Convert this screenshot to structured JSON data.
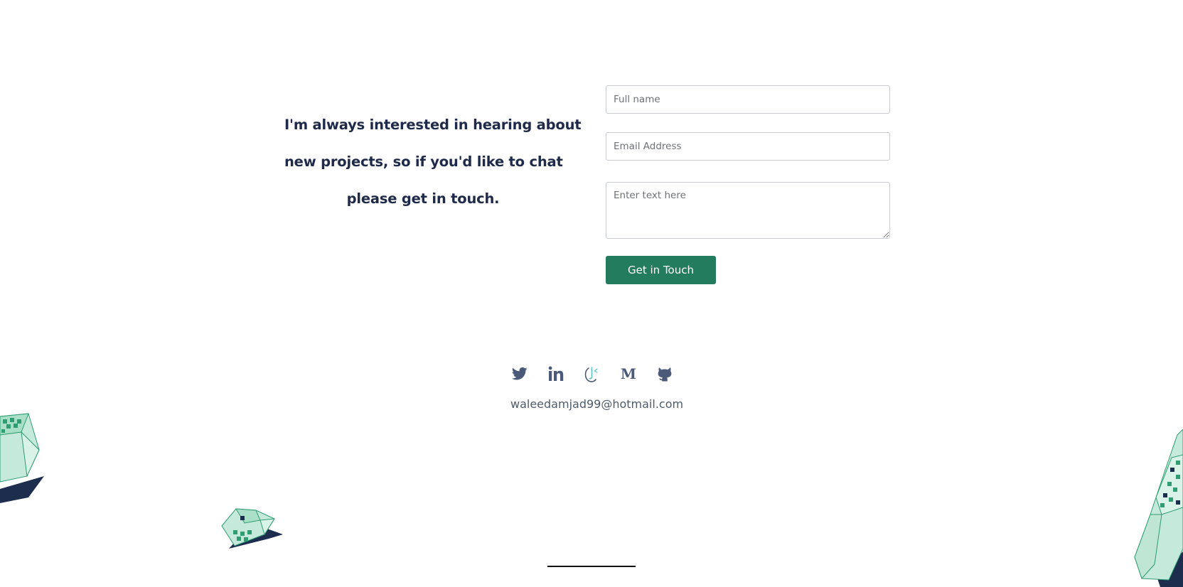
{
  "intro": {
    "lines": [
      "I'm always interested in hearing about",
      "new projects, so if you'd like to chat",
      "please get in touch."
    ]
  },
  "form": {
    "name_placeholder": "Full name",
    "email_placeholder": "Email Address",
    "message_placeholder": "Enter text here",
    "submit_label": "Get in Touch"
  },
  "social": {
    "links": [
      {
        "name": "twitter",
        "icon": "twitter-icon"
      },
      {
        "name": "linkedin",
        "icon": "linkedin-icon"
      },
      {
        "name": "codepen",
        "icon": "codepen-icon"
      },
      {
        "name": "medium",
        "icon": "medium-icon"
      },
      {
        "name": "github",
        "icon": "github-icon"
      }
    ]
  },
  "contact": {
    "email": "waleedamjad99@hotmail.com"
  },
  "colors": {
    "heading": "#1f2a4a",
    "button": "#227c5d",
    "icon": "#4a5a78",
    "email_text": "#4f5b6a",
    "accent_teal": "#5ec1c8",
    "crystal_fill": "#c5eadb",
    "crystal_stroke": "#2f9c72",
    "crystal_shadow": "#1d2d4e"
  }
}
